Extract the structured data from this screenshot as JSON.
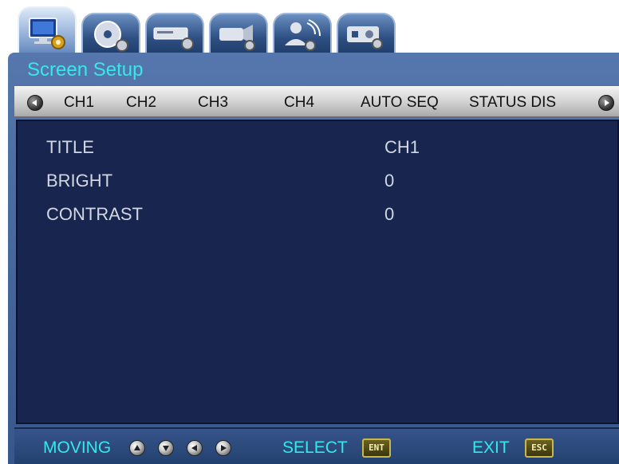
{
  "tabs": [
    {
      "icon": "monitor-settings-icon",
      "active": true
    },
    {
      "icon": "disc-settings-icon",
      "active": false
    },
    {
      "icon": "recorder-settings-icon",
      "active": false
    },
    {
      "icon": "camera-settings-icon",
      "active": false
    },
    {
      "icon": "user-network-settings-icon",
      "active": false
    },
    {
      "icon": "system-settings-icon",
      "active": false
    }
  ],
  "header": {
    "title": "Screen Setup"
  },
  "channel_bar": {
    "items": [
      "CH1",
      "CH2",
      "CH3",
      "CH4",
      "AUTO SEQ",
      "STATUS DIS"
    ],
    "selected": "CH1"
  },
  "settings": [
    {
      "label": "TITLE",
      "value": "CH1"
    },
    {
      "label": "BRIGHT",
      "value": "0"
    },
    {
      "label": "CONTRAST",
      "value": "0"
    }
  ],
  "footer": {
    "moving_label": "MOVING",
    "select_label": "SELECT",
    "select_key": "ENT",
    "exit_label": "EXIT",
    "exit_key": "ESC"
  },
  "colors": {
    "accent_cyan": "#38e8e8",
    "panel_bg": "#17254f",
    "frame_blue": "#37578c",
    "bar_gray": "#cfcfcf"
  }
}
